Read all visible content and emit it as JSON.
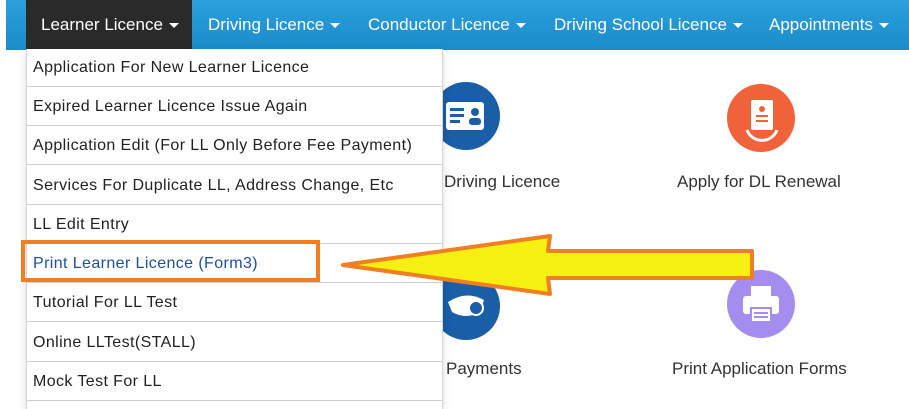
{
  "nav": {
    "items": [
      {
        "label": "Learner Licence"
      },
      {
        "label": "Driving Licence"
      },
      {
        "label": "Conductor Licence"
      },
      {
        "label": "Driving School Licence"
      },
      {
        "label": "Appointments"
      }
    ]
  },
  "dropdown": {
    "items": [
      {
        "label": "Application For New Learner Licence"
      },
      {
        "label": "Expired Learner Licence Issue Again"
      },
      {
        "label": "Application Edit (For LL Only Before Fee Payment)"
      },
      {
        "label": "Services For Duplicate LL, Address Change, Etc"
      },
      {
        "label": "LL Edit Entry"
      },
      {
        "label": "Print Learner Licence (Form3)"
      },
      {
        "label": "Tutorial For LL Test"
      },
      {
        "label": "Online LLTest(STALL)"
      },
      {
        "label": "Mock Test For LL"
      }
    ]
  },
  "cards": {
    "driving_licence": {
      "label": "Driving Licence",
      "icon": "id-card-icon",
      "color": "#1a5ea8"
    },
    "dl_renewal": {
      "label": "Apply for DL Renewal",
      "icon": "document-renewal-icon",
      "color": "#f0623a"
    },
    "payments": {
      "label": "Payments",
      "icon": "rupee-payment-icon",
      "color": "#1a5ea8"
    },
    "print_forms": {
      "label": "Print Application Forms",
      "icon": "printer-icon",
      "color": "#a58df0"
    }
  },
  "annotation": {
    "arrow_color": "#f5ef12",
    "outline_color": "#ef7f22"
  }
}
